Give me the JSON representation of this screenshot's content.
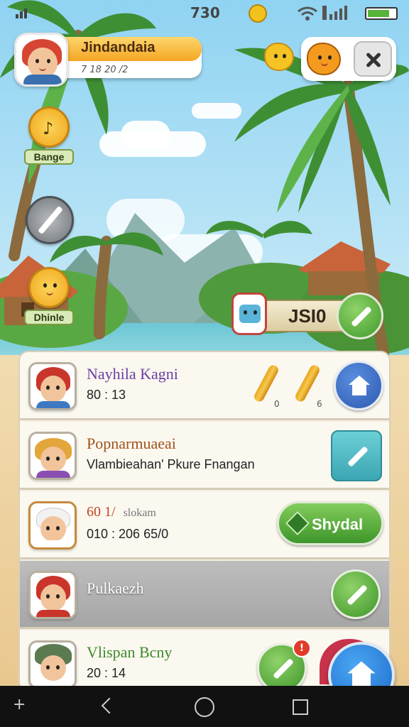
{
  "status_bar": {
    "time": "730"
  },
  "profile": {
    "name": "Jindandaia",
    "subtitle": "7 18 20 /2"
  },
  "side_badges": [
    {
      "label": "Bange",
      "icon": "music-note-icon"
    },
    {
      "label": "",
      "icon": "sword-icon"
    },
    {
      "label": "Dhinle",
      "icon": "smiley-icon"
    }
  ],
  "score": {
    "value": "JSI0"
  },
  "list": [
    {
      "title": "Nayhila Kagni",
      "line2": "80 : 13",
      "item_counts": [
        "0",
        "6"
      ],
      "title_color": "#6b3fa0"
    },
    {
      "title": "Popnarmuaeai",
      "line2": "Vlambieahan' Pkure Fnangan",
      "title_color": "#a0521c"
    },
    {
      "title": "60 1/",
      "title_extra": "slokam",
      "line2": "010 :  206 65/0",
      "button_label": "Shydal",
      "title_color": "#c1451b"
    },
    {
      "title": "Pulkaezh",
      "line2": "",
      "title_color": "#ffffff"
    },
    {
      "title": "Vlispan Bcny",
      "line2": "20 : 14",
      "badge": "!",
      "title_color": "#3d8a2a"
    }
  ],
  "colors": {
    "accent_orange": "#f5a623",
    "accent_green": "#3e962a",
    "accent_blue": "#2c5ab2",
    "panel": "#f4efe3"
  }
}
